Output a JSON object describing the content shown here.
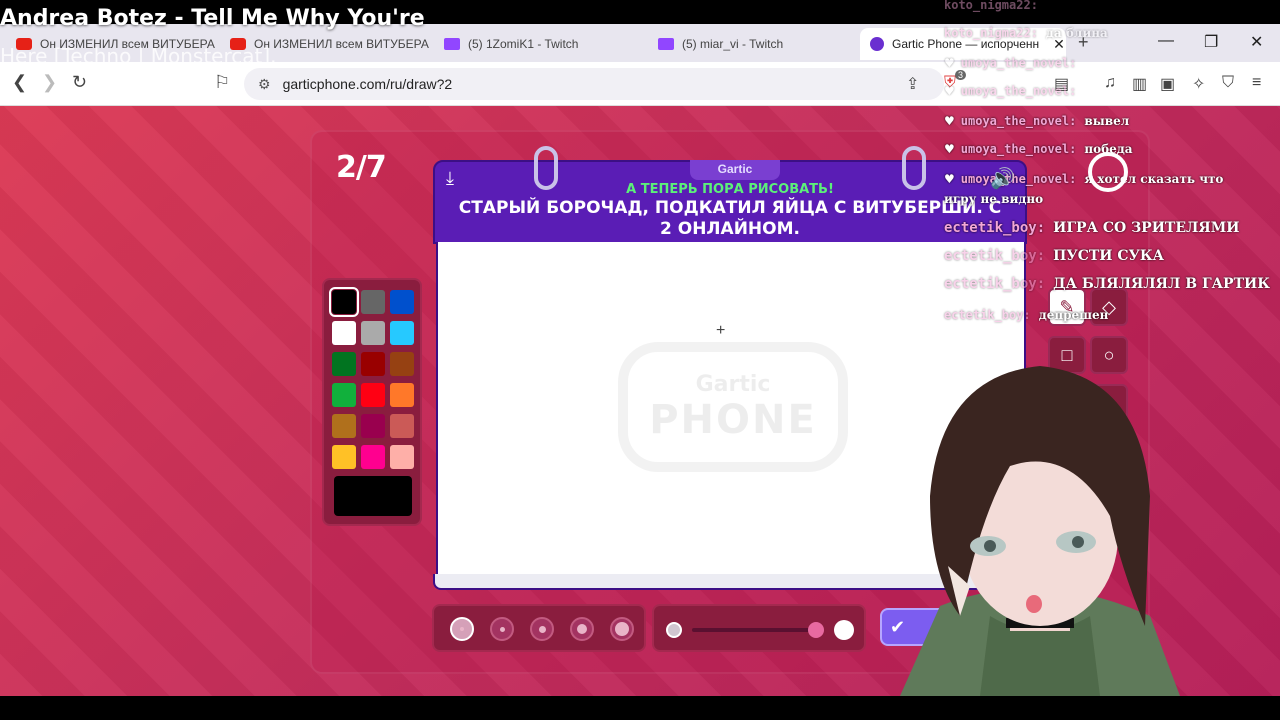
{
  "stream": {
    "title": "Andrea Botez - Tell Me Why You're",
    "subtitle": "Here [Techno | Monstercat]."
  },
  "browser": {
    "tabs": [
      {
        "label": "Он ИЗМЕНИЛ всем ВИТУБЕРА",
        "icon": "youtube-icon"
      },
      {
        "label": "Он ИЗМЕНИЛ всем ВИТУБЕРА",
        "icon": "youtube-icon"
      },
      {
        "label": "(5) 1ZomiK1 - Twitch",
        "icon": "twitch-icon"
      },
      {
        "label": "(5) miar_vi - Twitch",
        "icon": "twitch-icon"
      },
      {
        "label": "Gartic Phone — испорченн",
        "icon": "gartic-icon",
        "active": true
      }
    ],
    "url": "garticphone.com/ru/draw?2",
    "badge_count": "3"
  },
  "game": {
    "round": "2/7",
    "brand": "Gartic",
    "subhead": "А ТЕПЕРЬ ПОРА РИСОВАТЬ!",
    "prompt": "СТАРЫЙ БОРОЧАД, ПОДКАТИЛ ЯЙЦА С ВИТУБЕРШИ. С 2 ОНЛАЙНОМ.",
    "watermark_top": "Gartic",
    "watermark_bottom": "PHONE",
    "palette": [
      "#000000",
      "#666666",
      "#0050cd",
      "#ffffff",
      "#aaaaaa",
      "#26c9ff",
      "#017420",
      "#990000",
      "#964112",
      "#11b03c",
      "#ff0013",
      "#ff7829",
      "#b0701c",
      "#99004e",
      "#cb5a57",
      "#ffc126",
      "#ff008f",
      "#feafa8"
    ],
    "selected_color": "#000000"
  },
  "chat": [
    {
      "nick": "koto_nigma22:",
      "text": "",
      "faded": true
    },
    {
      "nick": "koto_nigma22:",
      "text": "да блина",
      "faded": true
    },
    {
      "nick": "umoya_the_novel:",
      "text": "",
      "faded": true
    },
    {
      "nick": "umoya_the_novel:",
      "text": "",
      "faded": true
    },
    {
      "nick": "umoya_the_novel:",
      "text": "вывел",
      "faded": false
    },
    {
      "nick": "umoya_the_novel:",
      "text": "победа",
      "faded": false
    },
    {
      "nick": "umoya_the_novel:",
      "text": "я хотел сказать что",
      "faded": false
    },
    {
      "nick": "",
      "text": "игру не видно",
      "faded": false
    },
    {
      "nick": "ectetik_boy:",
      "text": "ИГРА СО ЗРИТЕЛЯМИ",
      "faded": false
    },
    {
      "nick": "ectetik_boy:",
      "text": "ПУСТИ СУКА",
      "faded": false
    },
    {
      "nick": "ectetik_boy:",
      "text": "ДА БЛЯЛЯЛЯЛ В ГАРТИК",
      "faded": false
    },
    {
      "nick": "ectetik_boy:",
      "text": "депрешен",
      "faded": false
    }
  ]
}
